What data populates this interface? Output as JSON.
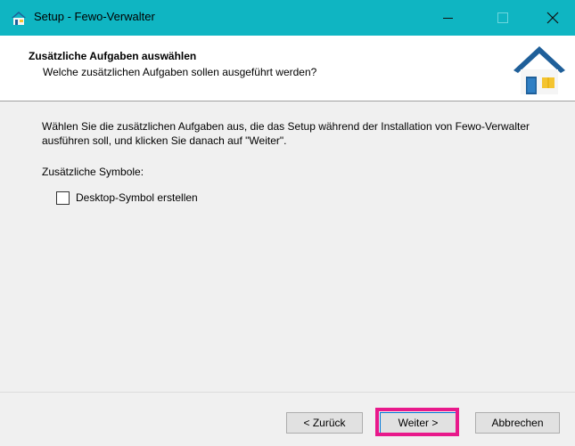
{
  "window": {
    "title": "Setup - Fewo-Verwalter",
    "icon": "house-icon",
    "controls": [
      "minimize-icon",
      "maximize-icon",
      "close-icon"
    ]
  },
  "header": {
    "title": "Zusätzliche Aufgaben auswählen",
    "subtitle": "Welche zusätzlichen Aufgaben sollen ausgeführt werden?",
    "logo": "house-logo-icon"
  },
  "content": {
    "description": "Wählen Sie die zusätzlichen Aufgaben aus, die das Setup während der Installation von Fewo-Verwalter ausführen soll, und klicken Sie danach auf \"Weiter\".",
    "section_label": "Zusätzliche Symbole:",
    "tasks": [
      {
        "label": "Desktop-Symbol erstellen",
        "checked": false
      }
    ]
  },
  "footer": {
    "back_label": "< Zurück",
    "next_label": "Weiter >",
    "cancel_label": "Abbrechen"
  },
  "colors": {
    "titlebar": "#0fb5c2",
    "highlight": "#e8198b",
    "house_roof": "#1f5f99",
    "house_body": "#f5f5f5",
    "window_yellow": "#f4c430"
  }
}
